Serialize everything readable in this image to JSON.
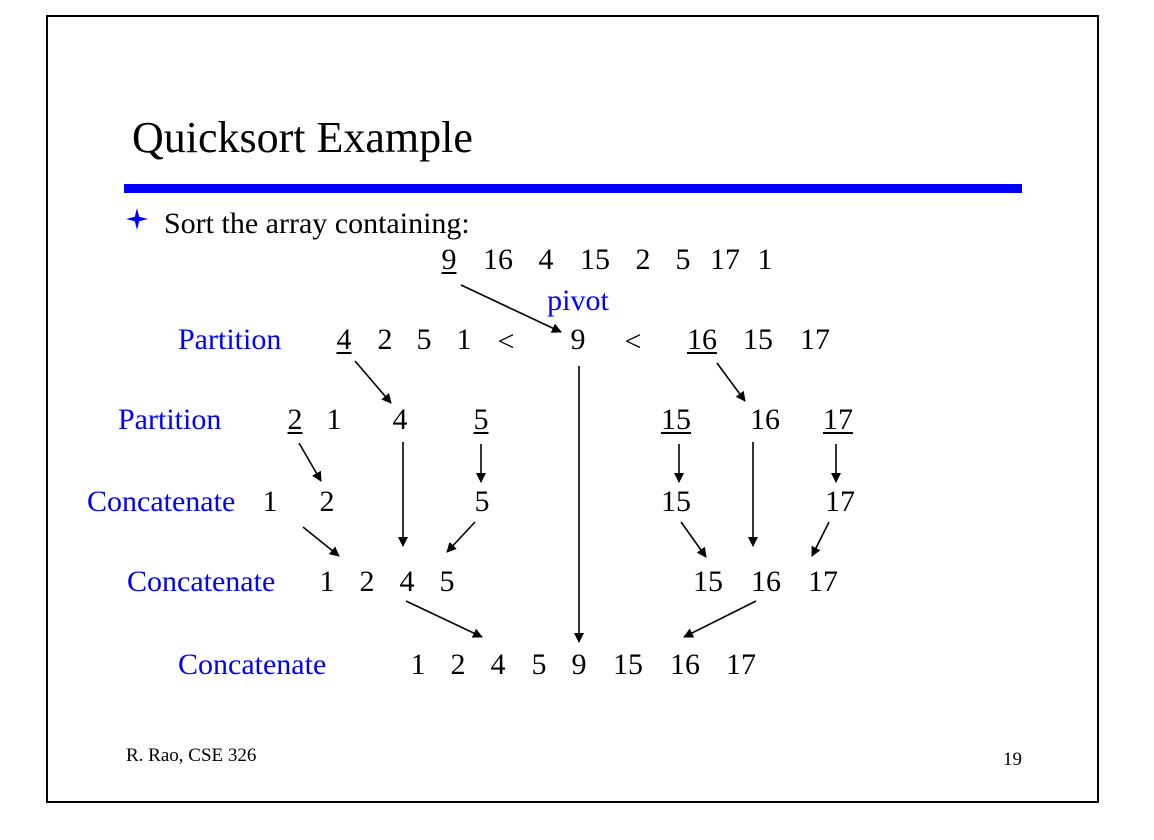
{
  "slide": {
    "title": "Quicksort Example",
    "bullet": "Sort the array containing:",
    "pivot_label": "pivot",
    "footer": "R. Rao, CSE 326",
    "page_number": "19",
    "colors": {
      "accent": "#0000ff",
      "text": "#000000",
      "background": "#ffffff"
    },
    "icons": {
      "bullet": "four-pointed-star-icon"
    }
  },
  "diagram": {
    "input_array": [
      "9",
      "16",
      "4",
      "15",
      "2",
      "5",
      "17",
      "1"
    ],
    "less_than": "<",
    "row_labels": [
      "Partition",
      "Partition",
      "Concatenate",
      "Concatenate",
      "Concatenate"
    ],
    "partition1": {
      "left": [
        "4",
        "2",
        "5",
        "1"
      ],
      "pivot": "9",
      "right": [
        "16",
        "15",
        "17"
      ]
    },
    "partition2": {
      "left_left": [
        "2",
        "1"
      ],
      "left_pivot": "4",
      "left_right": "5",
      "right_left": "15",
      "right_pivot": "16",
      "right_right": "17"
    },
    "concat1": {
      "sorted_pair": [
        "1",
        "2"
      ],
      "five": "5",
      "fifteen": "15",
      "seventeen": "17"
    },
    "concat2": {
      "left": [
        "1",
        "2",
        "4",
        "5"
      ],
      "right": [
        "15",
        "16",
        "17"
      ]
    },
    "result": [
      "1",
      "2",
      "4",
      "5",
      "9",
      "15",
      "16",
      "17"
    ]
  }
}
